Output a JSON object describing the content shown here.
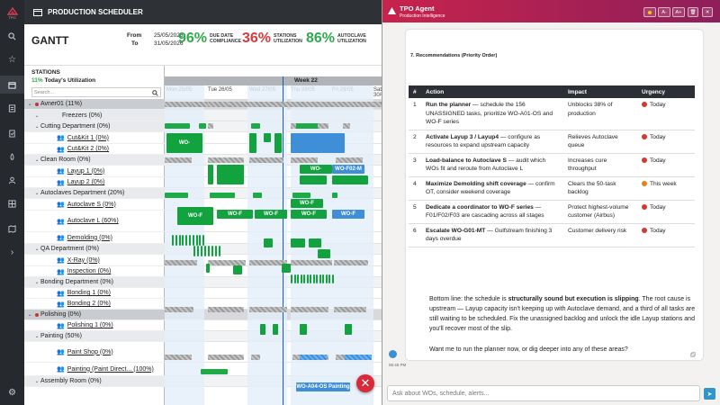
{
  "rail": {
    "logo": "TPO",
    "icons": [
      "search-icon",
      "star-icon",
      "calendar-icon",
      "list-icon",
      "tasks-icon",
      "rocket-icon",
      "user-icon",
      "grid-icon",
      "map-icon",
      "chevron-right-icon",
      "gear-icon"
    ]
  },
  "topbar": {
    "title": "PRODUCTION SCHEDULER"
  },
  "header": {
    "page_title": "GANTT",
    "from_label": "From",
    "from_value": "25/05/2026",
    "to_label": "To",
    "to_value": "31/05/2026",
    "kpis": [
      {
        "value": "96%",
        "label": "DUE DATE COMPLIANCE",
        "color": "#2eaa4d"
      },
      {
        "value": "36%",
        "label": "STATIONS UTILIZATION",
        "color": "#d83b3b"
      },
      {
        "value": "86%",
        "label": "AUTOCLAVE UTILIZATION",
        "color": "#2eaa4d"
      }
    ]
  },
  "stations": {
    "title": "STATIONS",
    "utilization_value": "11%",
    "utilization_label": "Today's Utilization",
    "search_placeholder": "Search...",
    "rows": [
      {
        "label": "Avner01 (11%)",
        "kind": "group"
      },
      {
        "label": "Freezers (0%)",
        "kind": "dept"
      },
      {
        "label": "Cutting Department (0%)",
        "kind": "dept"
      },
      {
        "label": "Cut&Kit 1 (0%)",
        "kind": "station"
      },
      {
        "label": "Cut&Kit 2 (0%)",
        "kind": "station"
      },
      {
        "label": "Clean Room (0%)",
        "kind": "dept"
      },
      {
        "label": "Layup 1 (0%)",
        "kind": "station"
      },
      {
        "label": "Layup 2 (0%)",
        "kind": "station"
      },
      {
        "label": "Autoclaves Department (20%)",
        "kind": "dept"
      },
      {
        "label": "Autoclave S (0%)",
        "kind": "station"
      },
      {
        "label": "Autoclave L (60%)",
        "kind": "station"
      },
      {
        "label": "Demolding (0%)",
        "kind": "station"
      },
      {
        "label": "QA Department (0%)",
        "kind": "dept"
      },
      {
        "label": "X-Ray (0%)",
        "kind": "station"
      },
      {
        "label": "Inspection (0%)",
        "kind": "station"
      },
      {
        "label": "Bonding Department (0%)",
        "kind": "dept"
      },
      {
        "label": "Bonding 1 (0%)",
        "kind": "station"
      },
      {
        "label": "Bonding 2 (0%)",
        "kind": "station"
      },
      {
        "label": "Polishing (0%)",
        "kind": "group"
      },
      {
        "label": "Polishing 1 (0%)",
        "kind": "station"
      },
      {
        "label": "Painting (50%)",
        "kind": "dept"
      },
      {
        "label": "Paint Shop (0%)",
        "kind": "station"
      },
      {
        "label": "Painting (Paint Direct... (100%)",
        "kind": "station"
      },
      {
        "label": "Assembly Room (0%)",
        "kind": "dept"
      }
    ]
  },
  "gantt": {
    "week_label": "Week 22",
    "days": [
      "Mon 25/05",
      "Tue 26/05",
      "Wed 27/05",
      "Thu 28/05",
      "Fri 29/05",
      "Sat 30/05"
    ],
    "block_labels": {
      "wo": "WO-",
      "wof": "WO-F",
      "wof02": "WO-F02-M",
      "woa04": "WO-A04-OS Painting"
    }
  },
  "chat": {
    "agent_name": "TPO Agent",
    "agent_subtitle": "Production Intelligence",
    "buttons": [
      "A-",
      "A+",
      "🗑",
      "✕"
    ],
    "rec_title": "7. Recommendations (Priority Order)",
    "columns": [
      "#",
      "Action",
      "Impact",
      "Urgency"
    ],
    "rows": [
      {
        "num": "1",
        "action_bold": "Run the planner",
        "action_rest": " — schedule the 156 UNASSIGNED tasks, prioritize WO-A01-OS and WO-F series",
        "impact": "Unblocks 38% of production",
        "urgency": "Today",
        "urg_color": "red"
      },
      {
        "num": "2",
        "action_bold": "Activate Layup 3 / Layup4",
        "action_rest": " — configure as resources to expand upstream capacity",
        "impact": "Relieves Autoclave queue",
        "urgency": "Today",
        "urg_color": "red"
      },
      {
        "num": "3",
        "action_bold": "Load-balance to Autoclave S",
        "action_rest": " — audit which WOs fit and reroute from Autoclave L",
        "impact": "Increases cure throughput",
        "urgency": "Today",
        "urg_color": "red"
      },
      {
        "num": "4",
        "action_bold": "Maximize Demolding shift coverage",
        "action_rest": " — confirm OT, consider weekend coverage",
        "impact": "Clears the 50-task backlog",
        "urgency": "This week",
        "urg_color": "orange"
      },
      {
        "num": "5",
        "action_bold": "Dedicate a coordinator to WO-F series",
        "action_rest": " — F01/F02/F03 are cascading across all stages",
        "impact": "Protect highest-volume customer (Airbus)",
        "urgency": "Today",
        "urg_color": "red"
      },
      {
        "num": "6",
        "action_bold": "Escalate WO-G01-MT",
        "action_rest": " — Gulfstream finishing 3 days overdue",
        "impact": "Customer delivery risk",
        "urgency": "Today",
        "urg_color": "red"
      }
    ],
    "bottom_pre": "Bottom line: the schedule is ",
    "bottom_bold1": "structurally sound but execution is slipping",
    "bottom_mid": ". The root cause is upstream — Layup capacity isn't keeping up with Autoclave demand, and a third of all tasks are still waiting to be scheduled. Fix the unassigned backlog and unlock the idle Layup stations and you'll recover most of the slip.",
    "ask": "Want me to run the planner now, or dig deeper into any of these areas?",
    "time": "06:45 PM",
    "input_placeholder": "Ask about WOs, schedule, alerts..."
  }
}
